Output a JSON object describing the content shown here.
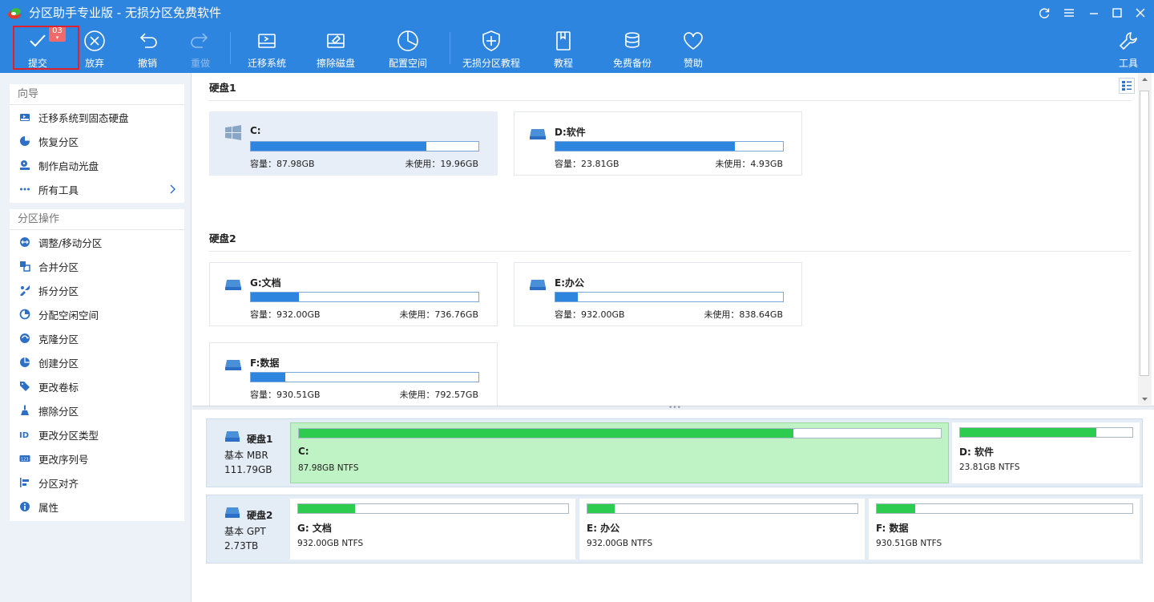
{
  "app": {
    "title": "分区助手专业版 - 无损分区免费软件"
  },
  "window_controls": [
    "refresh-icon",
    "menu-icon",
    "minimize-icon",
    "maximize-icon",
    "close-icon"
  ],
  "toolbar": {
    "commit": {
      "label": "提交",
      "badge": "03"
    },
    "discard": {
      "label": "放弃"
    },
    "undo": {
      "label": "撤销"
    },
    "redo": {
      "label": "重做"
    },
    "migrate": {
      "label": "迁移系统"
    },
    "wipe": {
      "label": "擦除磁盘"
    },
    "allocate": {
      "label": "配置空间"
    },
    "tutorial_lossless": {
      "label": "无损分区教程"
    },
    "tutorial": {
      "label": "教程"
    },
    "backup": {
      "label": "免费备份"
    },
    "donate": {
      "label": "赞助"
    },
    "tools": {
      "label": "工具"
    }
  },
  "sidebar": {
    "wizard": {
      "title": "向导",
      "items": [
        {
          "label": "迁移系统到固态硬盘",
          "icon": "migrate-ssd-icon"
        },
        {
          "label": "恢复分区",
          "icon": "recover-icon"
        },
        {
          "label": "制作启动光盘",
          "icon": "bootdisk-icon"
        },
        {
          "label": "所有工具",
          "icon": "more-icon"
        }
      ]
    },
    "operations": {
      "title": "分区操作",
      "items": [
        {
          "label": "调整/移动分区",
          "icon": "resize-icon"
        },
        {
          "label": "合并分区",
          "icon": "merge-icon"
        },
        {
          "label": "拆分分区",
          "icon": "split-icon"
        },
        {
          "label": "分配空闲空间",
          "icon": "allocate-icon"
        },
        {
          "label": "克隆分区",
          "icon": "clone-icon"
        },
        {
          "label": "创建分区",
          "icon": "create-icon"
        },
        {
          "label": "更改卷标",
          "icon": "label-icon"
        },
        {
          "label": "擦除分区",
          "icon": "wipe-icon"
        },
        {
          "label": "更改分区类型",
          "icon": "id-icon"
        },
        {
          "label": "更改序列号",
          "icon": "serial-icon"
        },
        {
          "label": "分区对齐",
          "icon": "align-icon"
        },
        {
          "label": "属性",
          "icon": "info-icon"
        }
      ]
    }
  },
  "disks_view": {
    "disk1": {
      "title": "硬盘1",
      "partitions": [
        {
          "name": "C:",
          "capacity_label": "容量：87.98GB",
          "free_label": "未使用：19.96GB",
          "used_fraction": 0.77
        },
        {
          "name": "D:软件",
          "capacity_label": "容量：23.81GB",
          "free_label": "未使用：4.93GB",
          "used_fraction": 0.79
        }
      ]
    },
    "disk2": {
      "title": "硬盘2",
      "partitions": [
        {
          "name": "G:文档",
          "capacity_label": "容量：932.00GB",
          "free_label": "未使用：736.76GB",
          "used_fraction": 0.21
        },
        {
          "name": "E:办公",
          "capacity_label": "容量：932.00GB",
          "free_label": "未使用：838.64GB",
          "used_fraction": 0.1
        },
        {
          "name": "F:数据",
          "capacity_label": "容量：930.51GB",
          "free_label": "未使用：792.57GB",
          "used_fraction": 0.15
        }
      ]
    }
  },
  "disk_map": {
    "disk1": {
      "name": "硬盘1",
      "type": "基本 MBR",
      "size": "111.79GB",
      "partitions": [
        {
          "name": "C:",
          "fs": "87.98GB NTFS",
          "used_fraction": 0.77,
          "selected": true
        },
        {
          "name": "D: 软件",
          "fs": "23.81GB NTFS",
          "used_fraction": 0.79,
          "selected": false
        }
      ]
    },
    "disk2": {
      "name": "硬盘2",
      "type": "基本 GPT",
      "size": "2.73TB",
      "partitions": [
        {
          "name": "G: 文档",
          "fs": "932.00GB NTFS",
          "used_fraction": 0.21
        },
        {
          "name": "E: 办公",
          "fs": "932.00GB NTFS",
          "used_fraction": 0.1
        },
        {
          "name": "F: 数据",
          "fs": "930.51GB NTFS",
          "used_fraction": 0.15
        }
      ]
    }
  },
  "colors": {
    "toolbar_bg": "#2d85e0",
    "usage_bar": "#2d85e0",
    "map_bar": "#2ecc4e",
    "selected_partition": "#bff2c5",
    "highlight_frame": "#e0202a"
  }
}
